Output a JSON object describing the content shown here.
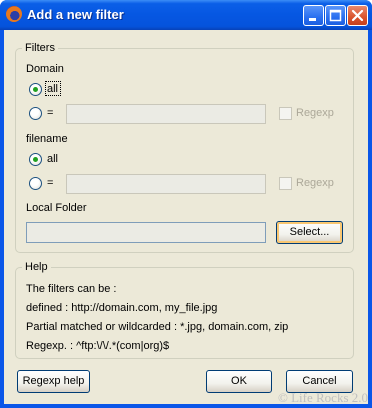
{
  "window": {
    "title": "Add a new filter",
    "icon": "firefox-icon"
  },
  "title_buttons": {
    "minimize": "minimize-icon",
    "maximize": "maximize-icon",
    "close": "close-icon"
  },
  "filters": {
    "legend": "Filters",
    "domain": {
      "label": "Domain",
      "option_all": "all",
      "option_equals": "=",
      "value": "",
      "regexp_label": "Regexp",
      "selected": "all"
    },
    "filename": {
      "label": "filename",
      "option_all": "all",
      "option_equals": "=",
      "value": "",
      "regexp_label": "Regexp",
      "selected": "all"
    },
    "local_folder": {
      "label": "Local Folder",
      "value": "",
      "select_button": "Select..."
    }
  },
  "help": {
    "legend": "Help",
    "line1": "The filters can be :",
    "line2": "defined : http://domain.com, my_file.jpg",
    "line3": "Partial matched or wildcarded : *.jpg, domain.com, zip",
    "line4": "Regexp. : ^ftp:\\/\\/.*(com|org)$"
  },
  "buttons": {
    "regexp_help": "Regexp help",
    "ok": "OK",
    "cancel": "Cancel"
  },
  "watermark": "© Life Rocks 2.0"
}
